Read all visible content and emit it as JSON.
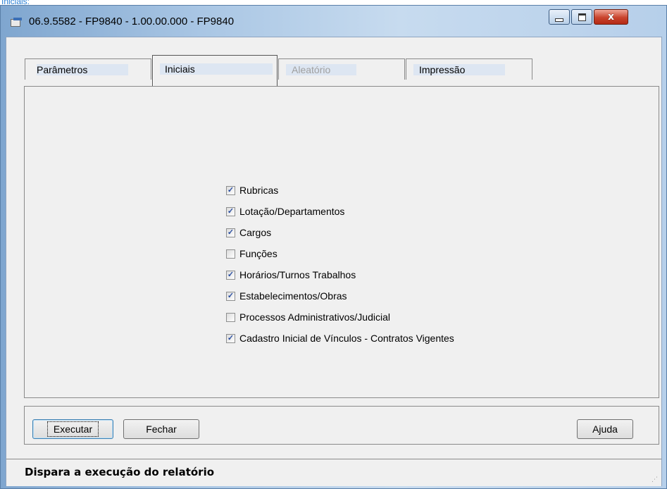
{
  "caption_above": "Iniciais:",
  "window": {
    "title": "06.9.5582 - FP9840 - 1.00.00.000 - FP9840",
    "controls": {
      "minimize": "minimize",
      "maximize": "maximize",
      "close": "x"
    }
  },
  "tabs": [
    {
      "label": "Parâmetros",
      "state": "normal"
    },
    {
      "label": "Iniciais",
      "state": "selected"
    },
    {
      "label": "Aleatório",
      "state": "disabled"
    },
    {
      "label": "Impressão",
      "state": "normal"
    }
  ],
  "options": [
    {
      "label": "Rubricas",
      "checked": true
    },
    {
      "label": "Lotação/Departamentos",
      "checked": true
    },
    {
      "label": "Cargos",
      "checked": true
    },
    {
      "label": "Funções",
      "checked": false
    },
    {
      "label": "Horários/Turnos Trabalhos",
      "checked": true
    },
    {
      "label": "Estabelecimentos/Obras",
      "checked": true
    },
    {
      "label": "Processos Administrativos/Judicial",
      "checked": false
    },
    {
      "label": "Cadastro Inicial de Vínculos - Contratos Vigentes",
      "checked": true
    }
  ],
  "buttons": {
    "execute": "Executar",
    "close": "Fechar",
    "help": "Ajuda"
  },
  "status": {
    "text": "Dispara a execução do relatório"
  },
  "colors": {
    "titlebar": "#b6cfea",
    "dialog_bg": "#f0f0f0",
    "check_mark": "#2a4ea0",
    "close_button": "#c8432c"
  }
}
